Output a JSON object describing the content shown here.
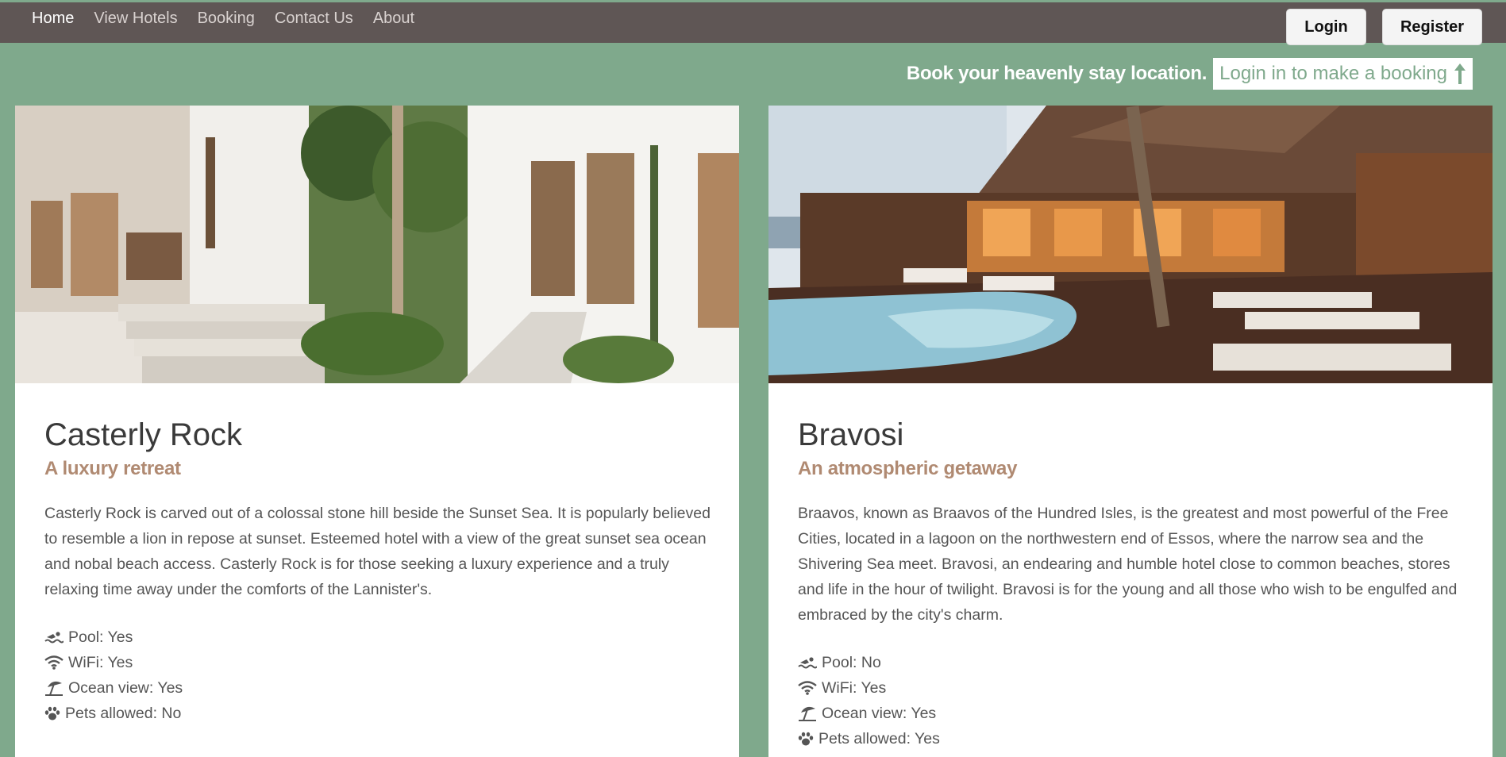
{
  "nav": {
    "links": [
      "Home",
      "View Hotels",
      "Booking",
      "Contact Us",
      "About"
    ],
    "login_label": "Login",
    "register_label": "Register"
  },
  "booking_bar": {
    "text": "Book your heavenly stay location.",
    "link_label": "Login in to make a booking"
  },
  "hotels": [
    {
      "name": "Casterly Rock",
      "tagline": "A luxury retreat",
      "description": "Casterly Rock is carved out of a colossal stone hill beside the Sunset Sea. It is popularly believed to resemble a lion in repose at sunset. Esteemed hotel with a view of the great sunset sea ocean and nobal beach access. Casterly Rock is for those seeking a luxury experience and a truly relaxing time away under the comforts of the Lannister's.",
      "amenities": [
        "Pool: Yes",
        "WiFi: Yes",
        "Ocean view: Yes",
        "Pets allowed: No"
      ]
    },
    {
      "name": "Bravosi",
      "tagline": "An atmospheric getaway",
      "description": "Braavos, known as Braavos of the Hundred Isles, is the greatest and most powerful of the Free Cities, located in a lagoon on the northwestern end of Essos, where the narrow sea and the Shivering Sea meet. Bravosi, an endearing and humble hotel close to common beaches, stores and life in the hour of twilight. Bravosi is for the young and all those who wish to be engulfed and embraced by the city's charm.",
      "amenities": [
        "Pool: No",
        "WiFi: Yes",
        "Ocean view: Yes",
        "Pets allowed: Yes"
      ]
    }
  ],
  "colors": {
    "background": "#7fa98c",
    "navbar": "#5f5655",
    "tagline": "#b08a72"
  },
  "icons": [
    "swimmer-icon",
    "wifi-icon",
    "umbrella-beach-icon",
    "paw-icon",
    "arrow-up-icon"
  ]
}
